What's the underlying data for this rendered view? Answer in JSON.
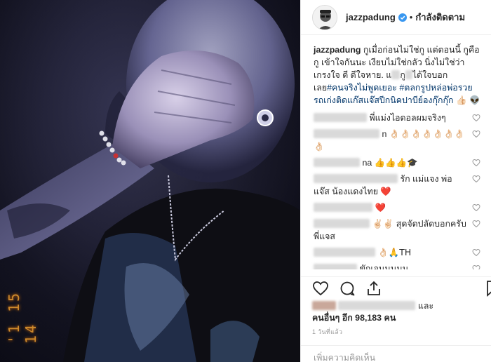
{
  "photo": {
    "alt": "",
    "timestamp_overlay": "'1 15 14"
  },
  "header": {
    "username": "jazzpadung",
    "separator": "•",
    "follow_status": "กำลังติดตาม",
    "verified_color": "#3897f0"
  },
  "caption": {
    "username": "jazzpadung",
    "text_1": "กูเมื่อก่อนไม่ใช่กู แต่ตอนนี้ กูคือกู เข้าใจกันนะ เงียบไม่ใช่กลัว นิ่งไม่ใช่ว่าเกรงใจ ดี ดีใจหาย. แ",
    "text_2": "กู",
    "text_3": "ได้ใจบอกเลย",
    "hashtag_1": "#คนจริงไม่พูดเยอะ",
    "hashtag_2": "#ตลกรูปหล่อพ่อรวยรถเก่งติดแก๊สแจ๊สปีกนิคปาบีย์องกุ๊กกุ๊ก",
    "emoji": "👍🏻 👽"
  },
  "comments": [
    {
      "text": "พี่แม่งไอดอลผมจริงๆ",
      "emoji": ""
    },
    {
      "text": "n",
      "emoji": "👌🏻👌🏻👌🏻👌🏻👌🏻👌🏻👌🏻👌🏻"
    },
    {
      "text": "na",
      "emoji": "👍👍👍🎓"
    },
    {
      "text": "รัก แม่แจง พ่อแจ๊ส น้องแดงไทย",
      "emoji": "❤️"
    },
    {
      "text": "",
      "emoji": "❤️"
    },
    {
      "text": "สุดจัดปลัดบอกครับพี่แจส",
      "emoji": "✌🏻✌🏻"
    },
    {
      "text": "",
      "emoji": "👌🏻🙏TH"
    },
    {
      "text": "ขักเจนนนนน",
      "emoji": ""
    },
    {
      "text": "",
      "emoji": "👌🏻👌🏻👌🏻👌🏻"
    }
  ],
  "likes": {
    "prefix": "และ",
    "others_label": "คนอื่นๆ อีก",
    "count": "98,183",
    "unit": "คน"
  },
  "time_ago": "1 วันที่แล้ว",
  "add_comment_placeholder": "เพิ่มความคิดเห็น"
}
